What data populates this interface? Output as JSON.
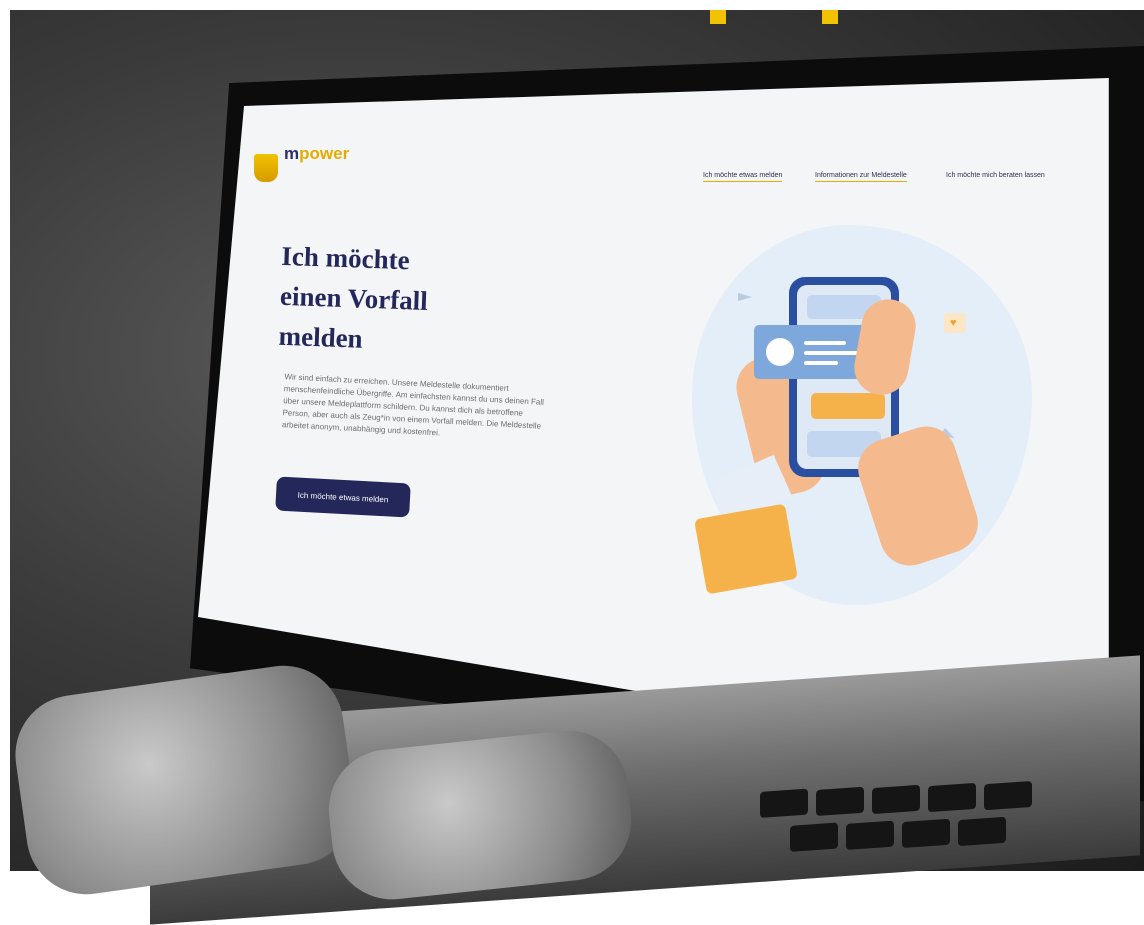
{
  "brand": {
    "logo_m": "m",
    "logo_rest": "power",
    "tagline_lines": [
      "",
      "",
      ""
    ]
  },
  "nav": {
    "items": [
      {
        "label": "Ich möchte etwas melden",
        "active": true
      },
      {
        "label": "Informationen zur Meldestelle",
        "active": true
      },
      {
        "label": "Ich möchte mich beraten lassen",
        "active": false
      }
    ]
  },
  "hero": {
    "title_lines": [
      "Ich möchte",
      "einen Vorfall",
      "melden"
    ],
    "body": "Wir sind einfach zu erreichen. Unsere Meldestelle dokumentiert menschenfeindliche Übergriffe. Am einfachsten kannst du uns deinen Fall über unsere Meldeplattform schildern. Du kannst dich als betroffene Person, aber auch als Zeug*in von einem Vorfall melden. Die Meldestelle arbeitet anonym, unabhängig und kostenfrei.",
    "cta_label": "Ich möchte etwas melden"
  },
  "illustration": {
    "name": "phone-chat-illustration",
    "icons": [
      "user-avatar-icon",
      "heart-icon",
      "paper-plane-icon"
    ]
  },
  "colors": {
    "brand_navy": "#24275a",
    "brand_yellow": "#f2c200",
    "illustration_blue": "#2b4fa0",
    "illustration_orange": "#f6b24a"
  }
}
